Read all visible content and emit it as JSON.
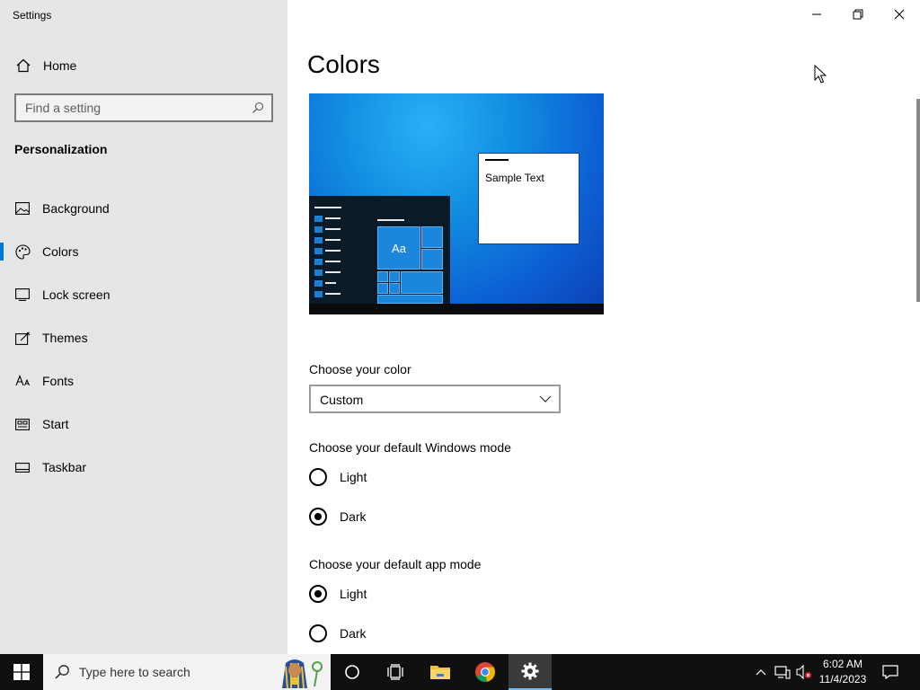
{
  "window": {
    "title": "Settings",
    "controls": {
      "minimize_icon": "minimize-icon",
      "restore_icon": "restore-icon",
      "close_icon": "close-icon"
    }
  },
  "sidebar": {
    "home_label": "Home",
    "search_placeholder": "Find a setting",
    "section_title": "Personalization",
    "items": [
      {
        "label": "Background",
        "icon": "picture-icon"
      },
      {
        "label": "Colors",
        "icon": "palette-icon",
        "active": true
      },
      {
        "label": "Lock screen",
        "icon": "lock-screen-icon"
      },
      {
        "label": "Themes",
        "icon": "themes-icon"
      },
      {
        "label": "Fonts",
        "icon": "fonts-icon"
      },
      {
        "label": "Start",
        "icon": "start-icon"
      },
      {
        "label": "Taskbar",
        "icon": "taskbar-icon"
      }
    ]
  },
  "main": {
    "title": "Colors",
    "preview": {
      "sample_text": "Sample Text",
      "tile_text": "Aa"
    },
    "color": {
      "label": "Choose your color",
      "selected": "Custom"
    },
    "windows_mode": {
      "label": "Choose your default Windows mode",
      "options": [
        {
          "label": "Light",
          "checked": false
        },
        {
          "label": "Dark",
          "checked": true
        }
      ]
    },
    "app_mode": {
      "label": "Choose your default app mode",
      "options": [
        {
          "label": "Light",
          "checked": true
        },
        {
          "label": "Dark",
          "checked": false
        }
      ]
    }
  },
  "taskbar": {
    "search_placeholder": "Type here to search",
    "time": "6:02 AM",
    "date": "11/4/2023"
  },
  "colors": {
    "accent": "#0078d7",
    "sidebar_bg": "#e6e6e6",
    "taskbar_bg": "#101010"
  }
}
